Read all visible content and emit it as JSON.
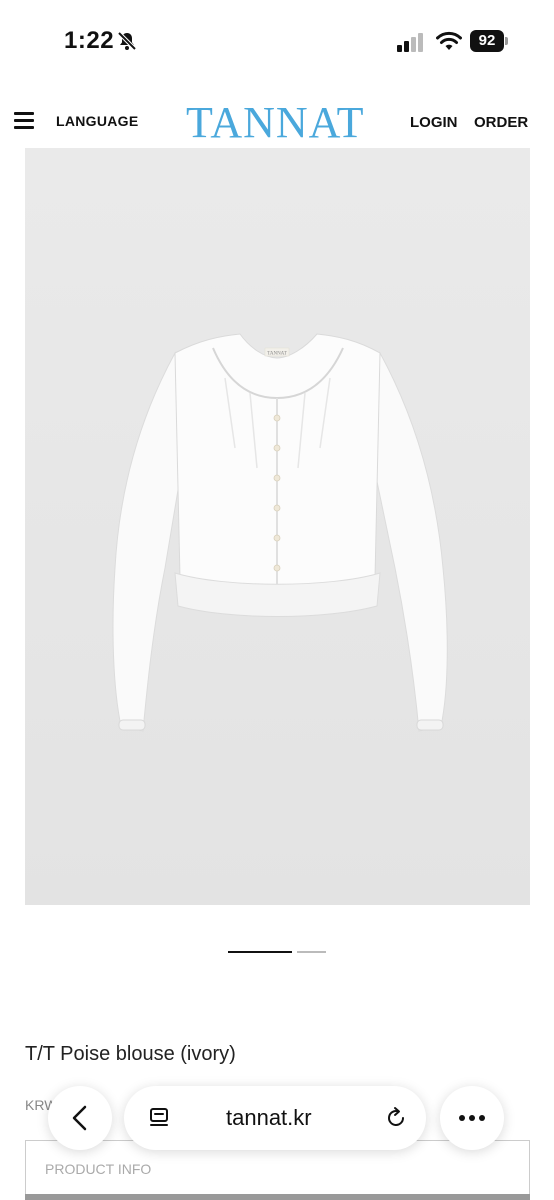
{
  "status_bar": {
    "time": "1:22",
    "battery": "92",
    "icons": [
      "bell-slash-icon",
      "signal-icon",
      "wifi-icon",
      "battery-icon"
    ]
  },
  "header": {
    "language_label": "LANGUAGE",
    "logo": "TANNAT",
    "login_label": "LOGIN",
    "order_label": "ORDER",
    "logo_color": "#4aa8dc"
  },
  "gallery": {
    "image_label": "TANNAT",
    "pages": 2,
    "active_page": 1
  },
  "product": {
    "name": "T/T Poise blouse (ivory)",
    "price": "KRW 0",
    "info_label": "PRODUCT INFO"
  },
  "browser": {
    "url": "tannat.kr",
    "icons": [
      "back-chevron-icon",
      "tabs-icon",
      "reload-icon",
      "more-dots-icon"
    ]
  }
}
